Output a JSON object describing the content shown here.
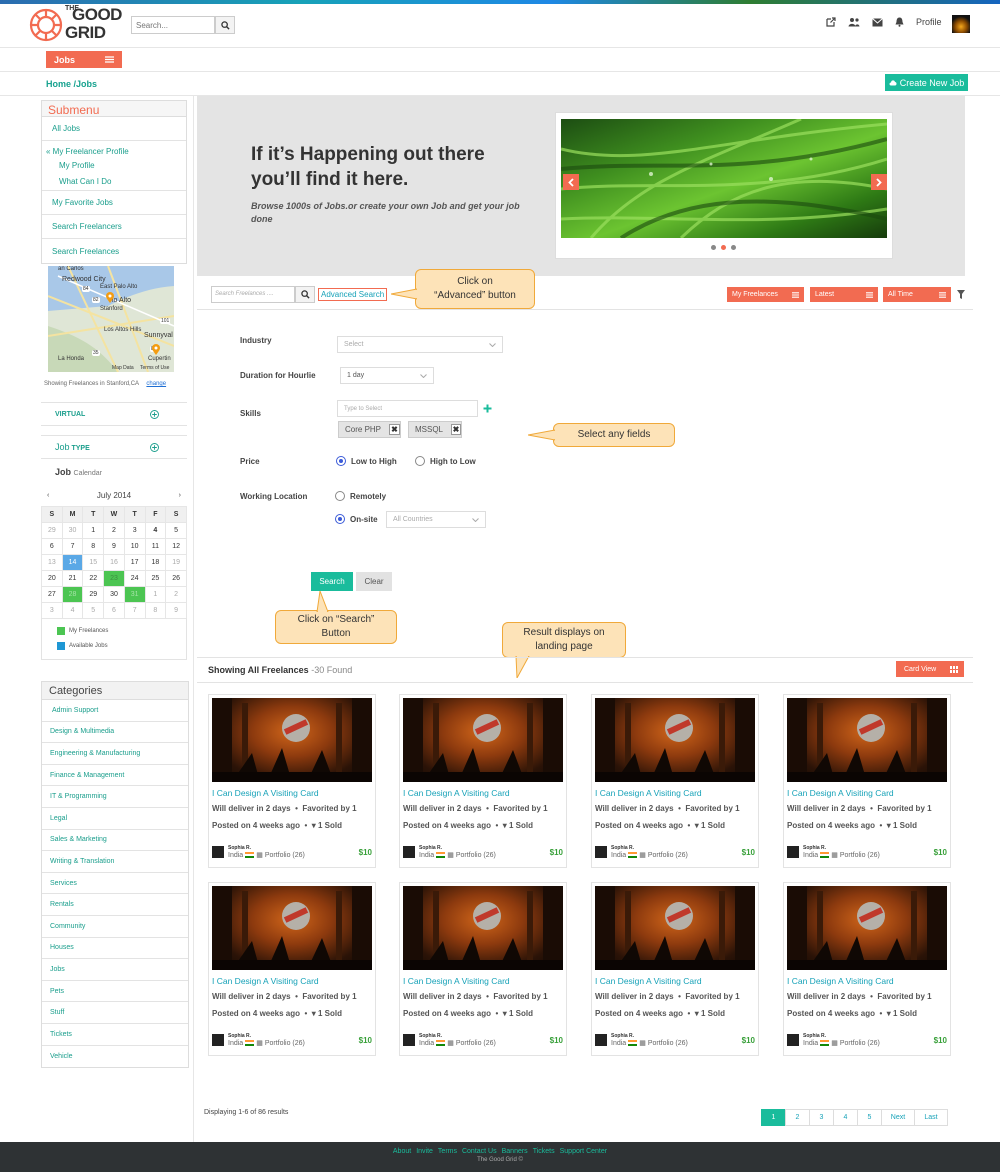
{
  "header": {
    "logo_the": "THE",
    "logo_good": "GOOD",
    "logo_grid": "GRID",
    "search_placeholder": "Search...",
    "profile_label": "Profile",
    "icons": [
      "external-link-icon",
      "users-icon",
      "mail-icon",
      "bell-icon"
    ]
  },
  "jobs_menu_label": "Jobs",
  "breadcrumb": "Home /Jobs",
  "create_job_label": "Create New Job",
  "submenu": {
    "title": "Submenu",
    "items": [
      "All Jobs",
      "« My Freelancer Profile",
      "My Profile",
      "What Can I Do",
      "My Favorite Jobs",
      "Search Freelancers",
      "Search Freelances"
    ]
  },
  "map": {
    "labels": [
      "an Carlos",
      "Redwood City",
      "East Palo Alto",
      "lo Alto",
      "Stanford",
      "Los Altos Hills",
      "Sunnyval",
      "La Honda",
      "Cupertin",
      "Map Data",
      "Terms of Use",
      "84",
      "82",
      "101",
      "85",
      "35"
    ],
    "showing_text": "Showing Freelances in Stanford,CA",
    "change_label": "change"
  },
  "sidebar_filters": {
    "virtual_label": "VIRTUAL",
    "job_type_label_a": "Job",
    "job_type_label_b": "TYPE",
    "job_calendar_a": "Job",
    "job_calendar_b": "Calendar"
  },
  "calendar": {
    "month": "July 2014",
    "prev": "‹",
    "next": "›",
    "dow": [
      "S",
      "M",
      "T",
      "W",
      "T",
      "F",
      "S"
    ],
    "weeks": [
      [
        "29",
        "30",
        "1",
        "2",
        "3",
        "4",
        "5"
      ],
      [
        "6",
        "7",
        "8",
        "9",
        "10",
        "11",
        "12"
      ],
      [
        "13",
        "14",
        "15",
        "16",
        "17",
        "18",
        "19"
      ],
      [
        "20",
        "21",
        "22",
        "23",
        "24",
        "25",
        "26"
      ],
      [
        "27",
        "28",
        "29",
        "30",
        "31",
        "1",
        "2"
      ],
      [
        "3",
        "4",
        "5",
        "6",
        "7",
        "8",
        "9"
      ]
    ],
    "legend_freelances": "My Freelances",
    "legend_jobs": "Available Jobs",
    "color_freelances": "#4cc552",
    "color_jobs": "#1f97d4"
  },
  "categories": {
    "title": "Categories",
    "items": [
      "Admin Support",
      "Design & Multimedia",
      "Engineering & Manufacturing",
      "Finance & Management",
      "IT & Programming",
      "Legal",
      "Sales & Marketing",
      "Writing & Translation",
      "Services",
      "Rentals",
      "Community",
      "Houses",
      "Jobs",
      "Pets",
      "Stuff",
      "Tickets",
      "Vehicle"
    ]
  },
  "hero": {
    "headline": "If it’s Happening out there you’ll find it here.",
    "sub": "Browse 1000s of Jobs.or create your own Job and get your job done"
  },
  "filter_bar": {
    "search_placeholder": "Search Freelances ....",
    "advanced_label": "Advanced Search",
    "my_freelances": "My Freelances",
    "latest": "Latest",
    "all_time": "All Time"
  },
  "callouts": {
    "advanced": [
      "Click on",
      "“Advanced” button"
    ],
    "fields": "Select any fields",
    "search": [
      "Click on “Search”",
      "Button"
    ],
    "result": [
      "Result displays on",
      "landing page"
    ]
  },
  "form": {
    "industry_label": "Industry",
    "industry_value": "Select",
    "duration_label": "Duration for Hourlie",
    "duration_value": "1 day",
    "skills_label": "Skills",
    "skills_placeholder": "Type to Select",
    "skill_tags": [
      "Core PHP",
      "MSSQL"
    ],
    "price_label": "Price",
    "price_low": "Low to High",
    "price_high": "High to Low",
    "location_label": "Working Location",
    "loc_remote": "Remotely",
    "loc_onsite": "On-site",
    "countries_value": "All Countries",
    "search_label": "Search",
    "clear_label": "Clear"
  },
  "results": {
    "heading": "Showing All Freelances",
    "count": " -30 Found",
    "card_view_label": "Card View",
    "card": {
      "title": "I Can Design A Visiting Card",
      "deliver": "Will deliver in 2 days",
      "favorited": "Favorited by 1",
      "posted": "Posted on 4 weeks ago",
      "sold": "1 Sold",
      "seller": "Sophia R.",
      "country": "India",
      "portfolio": "Portfolio (26)",
      "price": "$10"
    }
  },
  "pagination": {
    "summary": "Displaying 1-6 of 86 results",
    "pages": [
      "1",
      "2",
      "3",
      "4",
      "5",
      "Next",
      "Last"
    ]
  },
  "footer": {
    "links": [
      "About",
      "Invite",
      "Terms",
      "Contact Us",
      "Banners",
      "Tickets",
      "Support Center"
    ],
    "copyright": "The Good Grid ©"
  }
}
